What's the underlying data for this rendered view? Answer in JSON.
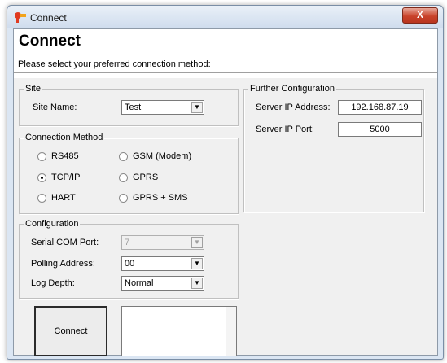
{
  "window": {
    "title": "Connect",
    "close_label": "X"
  },
  "header": {
    "heading": "Connect",
    "subheading": "Please select your preferred connection method:"
  },
  "site": {
    "group_label": "Site",
    "name_label": "Site Name:",
    "name_value": "Test"
  },
  "connection_method": {
    "group_label": "Connection Method",
    "options": [
      {
        "label": "RS485",
        "checked": false
      },
      {
        "label": "GSM (Modem)",
        "checked": false
      },
      {
        "label": "TCP/IP",
        "checked": true
      },
      {
        "label": "GPRS",
        "checked": false
      },
      {
        "label": "HART",
        "checked": false
      },
      {
        "label": "GPRS + SMS",
        "checked": false
      }
    ]
  },
  "configuration": {
    "group_label": "Configuration",
    "serial_com_label": "Serial COM Port:",
    "serial_com_value": "7",
    "polling_label": "Polling Address:",
    "polling_value": "00",
    "log_depth_label": "Log Depth:",
    "log_depth_value": "Normal"
  },
  "further_configuration": {
    "group_label": "Further Configuration",
    "server_ip_label": "Server IP Address:",
    "server_ip_value": "192.168.87.19",
    "server_port_label": "Server IP Port:",
    "server_port_value": "5000"
  },
  "actions": {
    "connect_label": "Connect"
  },
  "icons": {
    "app": "connect-plug-icon",
    "dropdown": "chevron-down-icon"
  }
}
